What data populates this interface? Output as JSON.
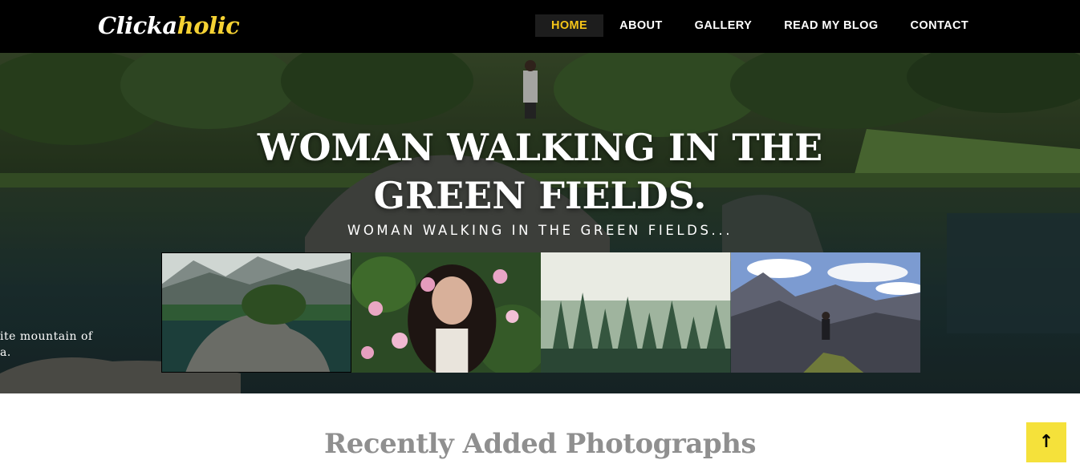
{
  "logo": {
    "part1": "Clicka",
    "part2": "holic"
  },
  "nav": {
    "items": [
      {
        "label": "HOME",
        "active": true
      },
      {
        "label": "ABOUT",
        "active": false
      },
      {
        "label": "GALLERY",
        "active": false
      },
      {
        "label": "READ MY BLOG",
        "active": false
      },
      {
        "label": "CONTACT",
        "active": false
      }
    ]
  },
  "hero": {
    "title": "WOMAN WALKING IN THE GREEN FIELDS.",
    "subtitle": "WOMAN WALKING IN THE GREEN FIELDS...",
    "side_caption": "ite mountain of\na.",
    "thumbnails": [
      {
        "name": "mountain-lake-thumbnail",
        "active": true
      },
      {
        "name": "woman-flowers-thumbnail",
        "active": false
      },
      {
        "name": "misty-forest-thumbnail",
        "active": false
      },
      {
        "name": "man-on-mountain-thumbnail",
        "active": false
      }
    ]
  },
  "section": {
    "title": "Recently Added Photographs"
  },
  "scroll_top": {
    "icon": "arrow-up-icon",
    "glyph": "↑"
  },
  "colors": {
    "accent": "#f5c518",
    "scroll_button": "#f5e13a",
    "navbar": "#000000",
    "section_title": "#8f8f8f"
  }
}
